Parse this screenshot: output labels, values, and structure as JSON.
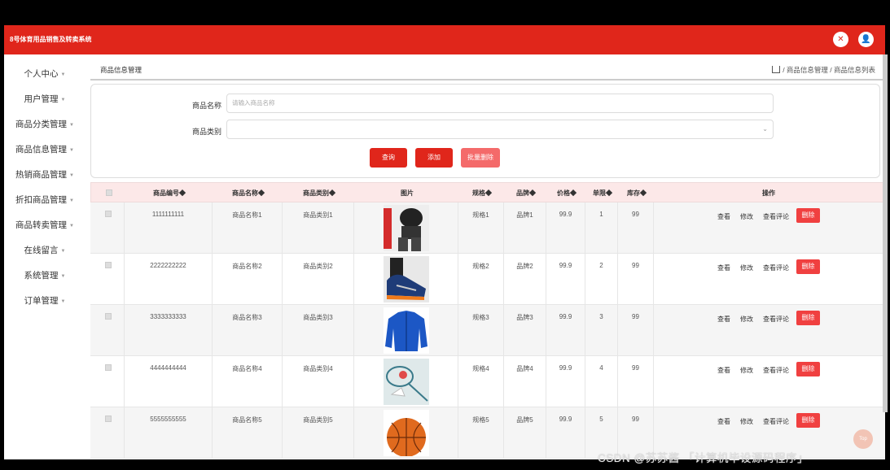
{
  "app": {
    "title": "8号体育用品销售及转卖系统"
  },
  "header": {
    "icons": [
      "close-icon",
      "user-icon"
    ]
  },
  "sidebar": {
    "items": [
      {
        "label": "个人中心"
      },
      {
        "label": "用户管理"
      },
      {
        "label": "商品分类管理"
      },
      {
        "label": "商品信息管理"
      },
      {
        "label": "热销商品管理"
      },
      {
        "label": "折扣商品管理"
      },
      {
        "label": "商品转卖管理"
      },
      {
        "label": "在线留言"
      },
      {
        "label": "系统管理"
      },
      {
        "label": "订单管理"
      }
    ]
  },
  "breadcrumb": {
    "page_title": "商品信息管理",
    "trail": "/ 商品信息管理 / 商品信息列表"
  },
  "search": {
    "name_label": "商品名称",
    "name_placeholder": "请输入商品名称",
    "category_label": "商品类别",
    "category_value": "",
    "query_button": "查询",
    "add_button": "添加",
    "batch_delete_button": "批量删除"
  },
  "colors": {
    "accent": "#e0261b",
    "delete": "#f04040",
    "header_bg": "#fce8e8"
  },
  "table": {
    "headers": [
      "商品编号◆",
      "商品名称◆",
      "商品类别◆",
      "图片",
      "规格◆",
      "品牌◆",
      "价格◆",
      "单限◆",
      "库存◆",
      "操作"
    ],
    "actions": {
      "view": "查看",
      "edit": "修改",
      "comments": "查看评论",
      "delete": "删除"
    },
    "rows": [
      {
        "id": "1111111111",
        "name": "商品名称1",
        "category": "商品类别1",
        "image": "sportswear-photo",
        "spec": "规格1",
        "brand": "品牌1",
        "price": "99.9",
        "limit": "1",
        "stock": "99"
      },
      {
        "id": "2222222222",
        "name": "商品名称2",
        "category": "商品类别2",
        "image": "sneaker-photo",
        "spec": "规格2",
        "brand": "品牌2",
        "price": "99.9",
        "limit": "2",
        "stock": "99"
      },
      {
        "id": "3333333333",
        "name": "商品名称3",
        "category": "商品类别3",
        "image": "jacket-photo",
        "spec": "规格3",
        "brand": "品牌3",
        "price": "99.9",
        "limit": "3",
        "stock": "99"
      },
      {
        "id": "4444444444",
        "name": "商品名称4",
        "category": "商品类别4",
        "image": "badminton-photo",
        "spec": "规格4",
        "brand": "品牌4",
        "price": "99.9",
        "limit": "4",
        "stock": "99"
      },
      {
        "id": "5555555555",
        "name": "商品名称5",
        "category": "商品类别5",
        "image": "basketball-photo",
        "spec": "规格5",
        "brand": "品牌5",
        "price": "99.9",
        "limit": "5",
        "stock": "99"
      }
    ]
  },
  "top_button": "Top",
  "watermark": "CSDN @苏苏酱  「计算机毕设源码程序」"
}
